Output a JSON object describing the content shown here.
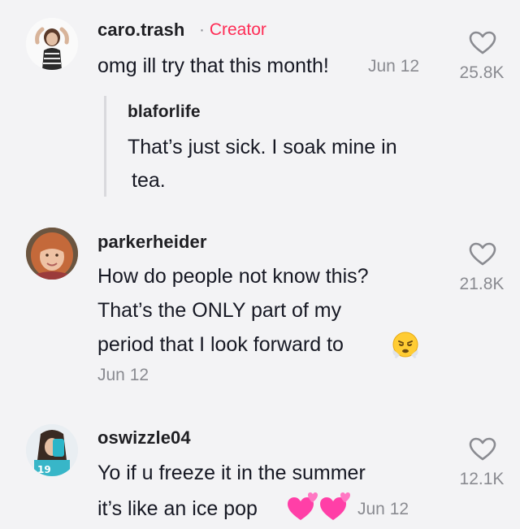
{
  "comments": [
    {
      "username": "caro.trash",
      "separator": "·",
      "badge": "Creator",
      "lines": [
        "omg ill try that this month!"
      ],
      "date": "Jun 12",
      "likes": "25.8K",
      "reply": {
        "username": "blaforlife",
        "lines": [
          "That’s just sick. I soak mine in",
          "tea."
        ]
      }
    },
    {
      "username": "parkerheider",
      "lines": [
        "How do people not know this?",
        "That’s the ONLY part of my",
        "period that I look forward to"
      ],
      "emoji": "face-with-steam-icon",
      "date": "Jun 12",
      "likes": "21.8K"
    },
    {
      "username": "oswizzle04",
      "lines": [
        "Yo if u freeze it in the summer",
        "it’s like an ice pop"
      ],
      "emoji": "two-hearts-icon",
      "date": "Jun 12",
      "likes": "12.1K"
    }
  ],
  "colors": {
    "background": "#f3f3f5",
    "creator_badge": "#fe2c55",
    "muted": "#8a8b91"
  }
}
